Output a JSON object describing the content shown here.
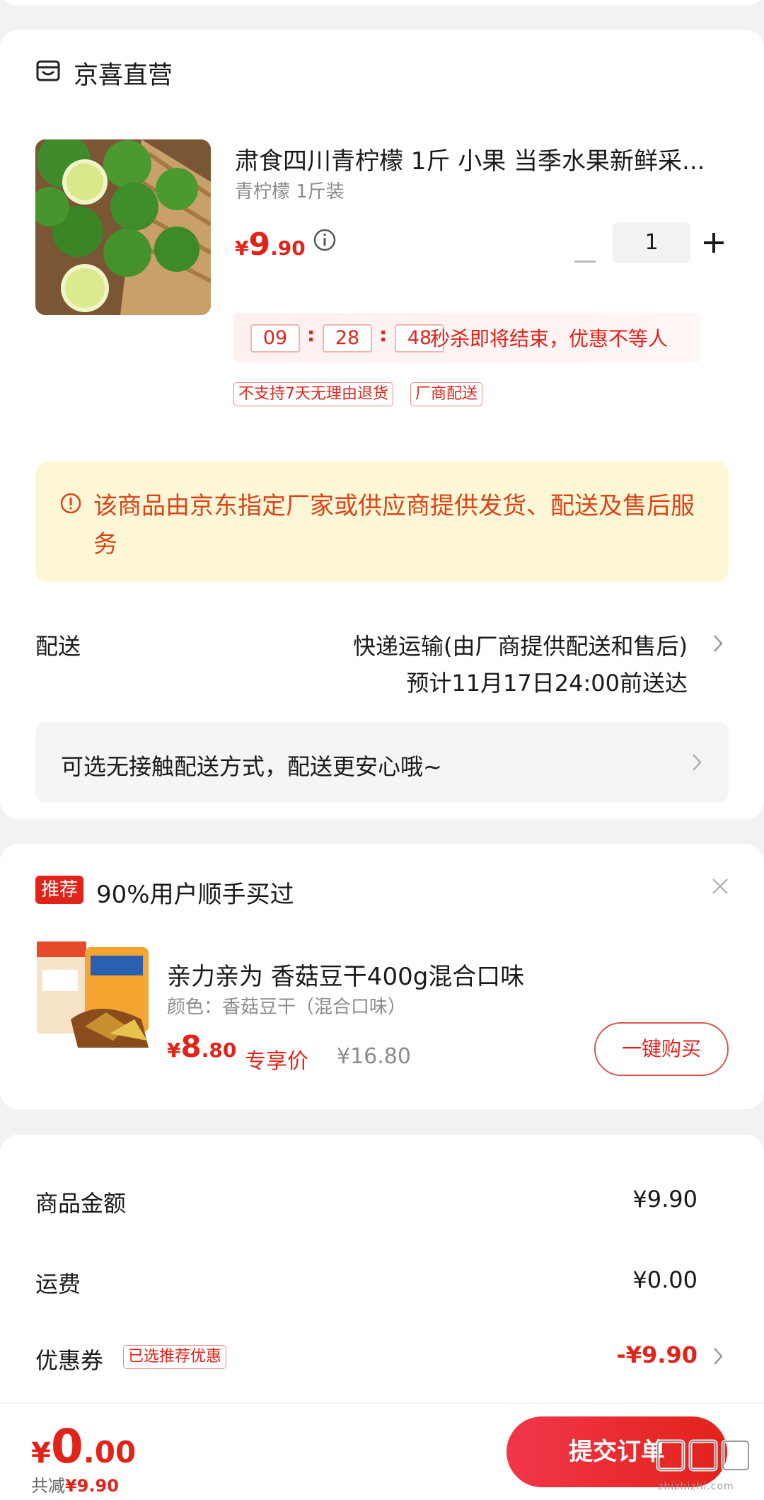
{
  "store": {
    "name": "京喜直营"
  },
  "product": {
    "title": "肃食四川青柠檬 1斤 小果 当季水果新鲜采...",
    "spec": "青柠檬 1斤装",
    "price_symbol": "¥",
    "price_int": "9",
    "price_dec": ".90",
    "quantity": "1",
    "countdown": {
      "h": "09",
      "m": "28",
      "s": "48"
    },
    "flash_text": "秒杀即将结束，优惠不等人",
    "tags": [
      "不支持7天无理由退货",
      "厂商配送"
    ]
  },
  "notice": {
    "text": "该商品由京东指定厂家或供应商提供发货、配送及售后服务"
  },
  "delivery": {
    "label": "配送",
    "method": "快递运输(由厂商提供配送和售后)",
    "eta": "预计11月17日24:00前送达",
    "contactless": "可选无接触配送方式，配送更安心哦~"
  },
  "recommend": {
    "badge": "推荐",
    "title": "90%用户顺手买过",
    "name": "亲力亲为 香菇豆干400g混合口味",
    "color": "颜色：香菇豆干（混合口味）",
    "price_symbol": "¥",
    "price_int": "8",
    "price_dec": ".80",
    "exclusive": "专享价",
    "original": "¥16.80",
    "buy_label": "一键购买"
  },
  "summary": {
    "goods_label": "商品金额",
    "goods_value": "¥9.90",
    "shipping_label": "运费",
    "shipping_value": "¥0.00",
    "coupon_label": "优惠券",
    "coupon_tag": "已选推荐优惠",
    "coupon_value": "-¥9.90"
  },
  "bottom": {
    "total_symbol": "¥",
    "total_int": "0",
    "total_dec": ".00",
    "saved_label": "共减",
    "saved_value": "¥9.90",
    "submit_label": "提交订单"
  },
  "watermark": {
    "text": "zhizhizhi.com"
  },
  "colors": {
    "accent": "#e2231a",
    "notice_bg": "#fef7d6",
    "notice_text": "#d9451b"
  }
}
